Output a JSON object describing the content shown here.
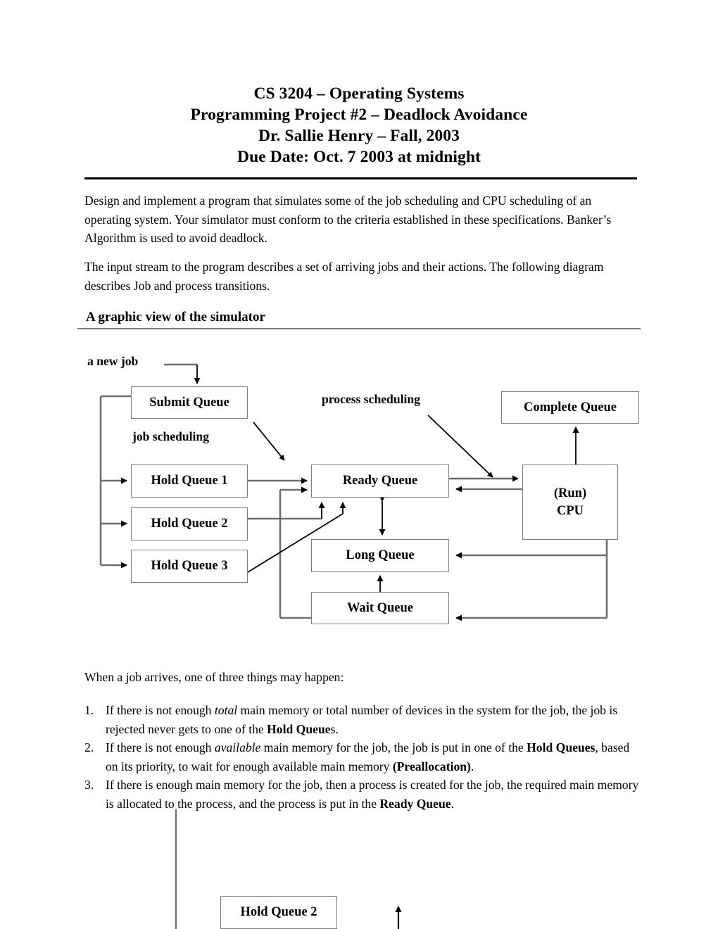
{
  "document": {
    "title_lines": [
      "CS 3204 – Operating Systems",
      "Programming Project #2 – Deadlock Avoidance",
      "Dr. Sallie Henry – Fall, 2003",
      "Due Date: Oct. 7 2003 at midnight"
    ],
    "paragraph_1": "Design and implement a program that simulates some of the job scheduling and CPU scheduling of an operating system. Your simulator must conform to the criteria established in these specifications. Banker’s Algorithm is used to avoid deadlock.",
    "paragraph_2": "The input stream to the program describes a set of arriving jobs and their actions. The following diagram describes Job and process transitions.",
    "section_heading": "A graphic view of the simulator",
    "paragraph_3": "When a job arrives, one of three things may happen:",
    "list": {
      "item1": {
        "number": "1.",
        "part_a": "If there is not enough ",
        "italic_a": "total",
        "part_b": " main memory or total number of devices in the system for the job, the job is rejected never gets to one of the ",
        "bold_a": "Hold Queue",
        "part_c": "s."
      },
      "item2": {
        "number": "2.",
        "part_a": "If there is not enough ",
        "italic_a": "available",
        "part_b": " main memory for the job, the job is put in one of the ",
        "bold_a": "Hold Queues",
        "part_c": ", based on its priority, to wait for enough available main memory ",
        "bold_b": "(Preallocation)",
        "part_d": "."
      },
      "item3": {
        "number": "3.",
        "part_a": "If there is enough main memory for the job, then a process is created for the job, the required main memory is allocated to the process, and the process is put in the ",
        "bold_a": "Ready Queue",
        "part_b": "."
      }
    }
  },
  "diagram": {
    "labels": {
      "new_job": "a new job",
      "job_scheduling": "job scheduling",
      "process_scheduling": "process scheduling"
    },
    "boxes": {
      "submit_queue": "Submit Queue",
      "hold_queue_1": "Hold Queue 1",
      "hold_queue_2": "Hold Queue 2",
      "hold_queue_3": "Hold Queue 3",
      "ready_queue": "Ready Queue",
      "long_queue": "Long Queue",
      "wait_queue": "Wait Queue",
      "complete_queue": "Complete Queue",
      "cpu_line1": "(Run)",
      "cpu_line2": "CPU"
    }
  },
  "bottom_diagram": {
    "hold_queue_2": "Hold Queue 2"
  },
  "colors": {
    "text": "#000000",
    "box_border": "#7d7d7d",
    "connector": "#6f6f6f",
    "rule": "#000000",
    "section_rule": "#7a7a7a",
    "page_background": "#ffffff"
  }
}
